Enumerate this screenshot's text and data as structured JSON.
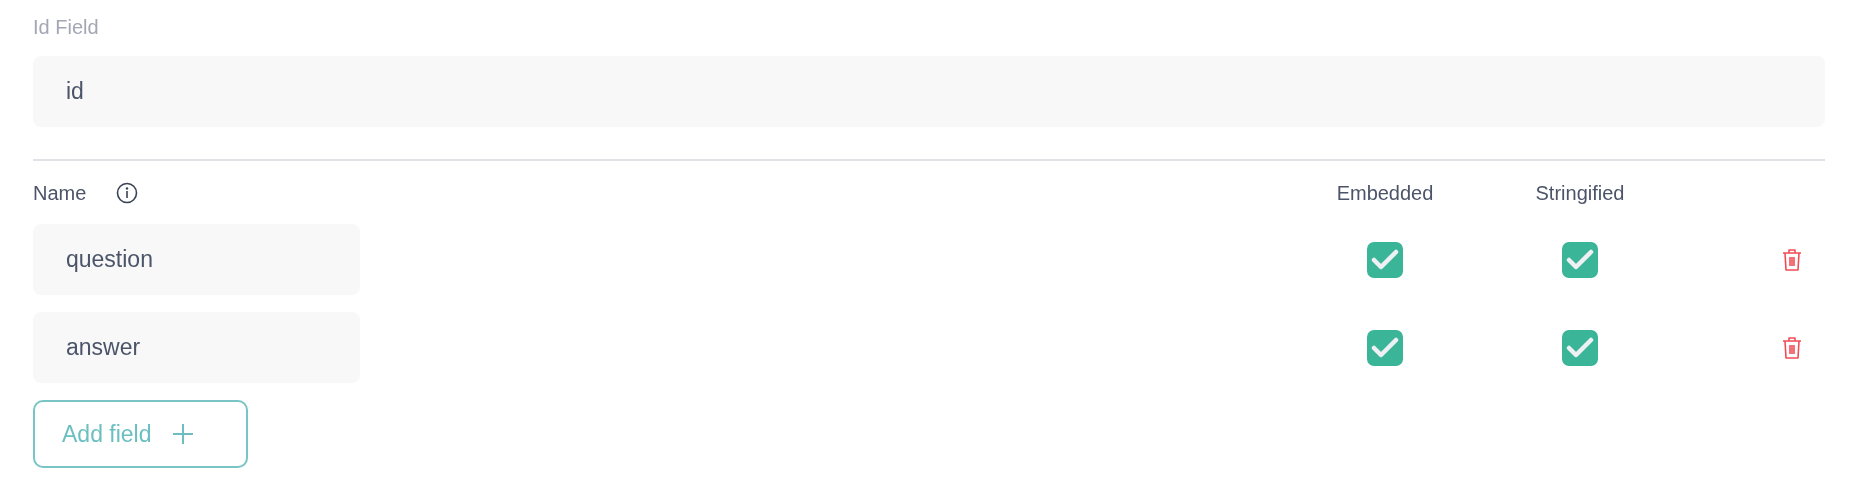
{
  "id_field": {
    "label": "Id Field",
    "value": "id"
  },
  "columns": {
    "name": "Name",
    "embedded": "Embedded",
    "stringified": "Stringified"
  },
  "fields": [
    {
      "name": "question",
      "embedded": true,
      "stringified": true
    },
    {
      "name": "answer",
      "embedded": true,
      "stringified": true
    }
  ],
  "add_button": {
    "label": "Add field"
  }
}
